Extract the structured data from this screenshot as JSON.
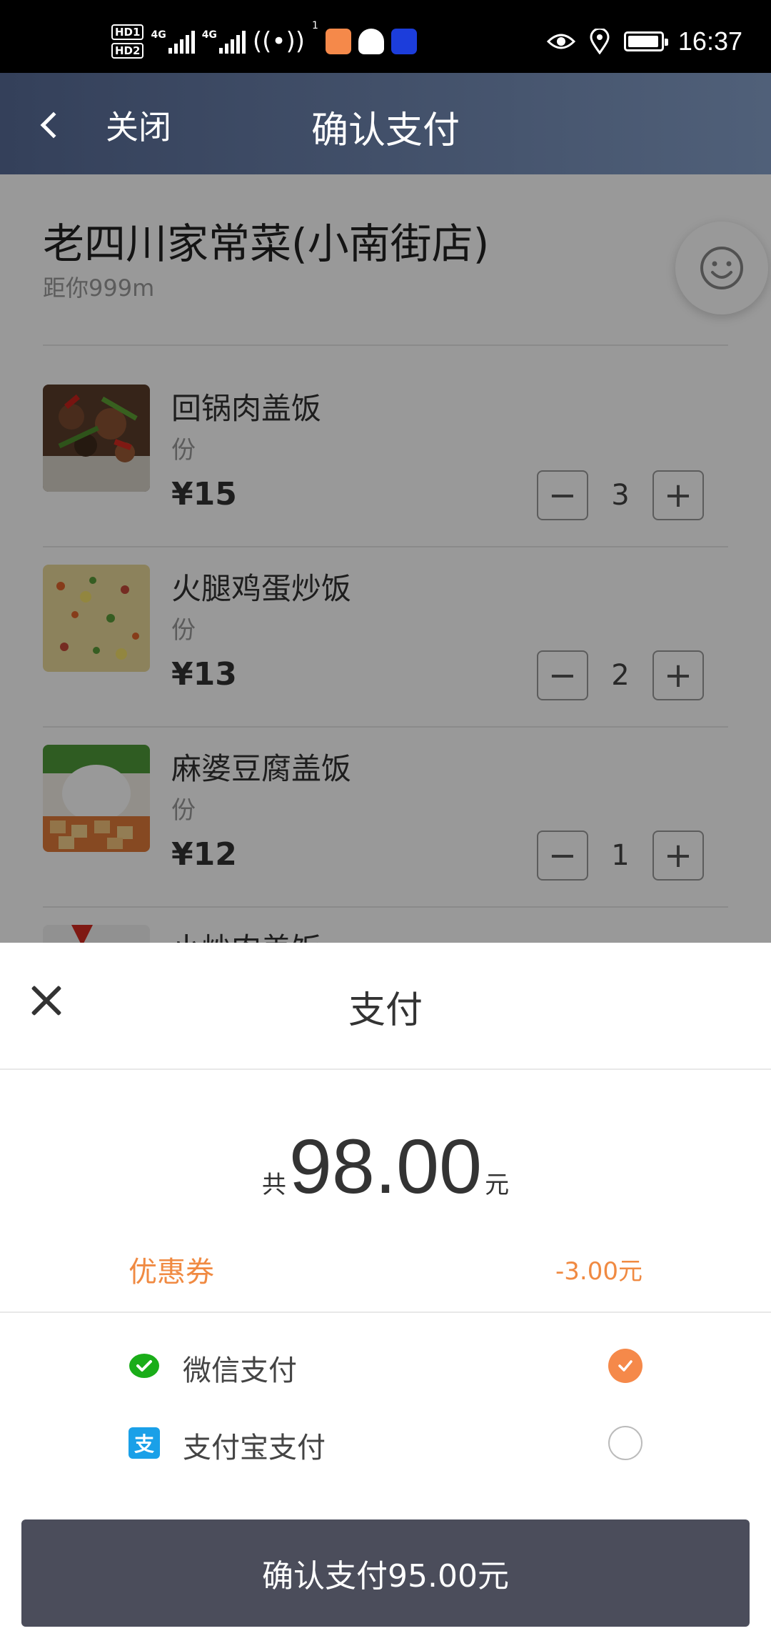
{
  "status_bar": {
    "time": "16:37",
    "network_1": "4G",
    "network_2": "4G",
    "hd_1": "HD1",
    "hd_2": "HD2",
    "hotspot_count": "1"
  },
  "nav": {
    "back_label": "关闭",
    "title": "确认支付"
  },
  "restaurant": {
    "name": "老四川家常菜(小南街店)",
    "distance": "距你999m"
  },
  "dishes": [
    {
      "name": "回锅肉盖饭",
      "unit": "份",
      "price": "¥15",
      "qty": "3"
    },
    {
      "name": "火腿鸡蛋炒饭",
      "unit": "份",
      "price": "¥13",
      "qty": "2"
    },
    {
      "name": "麻婆豆腐盖饭",
      "unit": "份",
      "price": "¥12",
      "qty": "1"
    },
    {
      "name": "小炒肉盖饭"
    }
  ],
  "stepper": {
    "minus": "−",
    "plus": "+"
  },
  "payment": {
    "title": "支付",
    "total_prefix": "共",
    "total_amount": "98.00",
    "total_suffix": "元",
    "coupon_label": "优惠券",
    "coupon_value": "-3.00元",
    "methods": [
      {
        "label": "微信支付",
        "selected": true
      },
      {
        "label": "支付宝支付",
        "selected": false
      }
    ],
    "confirm_label": "确认支付95.00元"
  },
  "colors": {
    "accent": "#f5894a",
    "coupon": "#f08a42",
    "nav_start": "#34405a",
    "nav_end": "#506079",
    "confirm_button": "#4b4d5b",
    "wechat_green": "#1aad19",
    "alipay_blue": "#1aa0e8"
  }
}
